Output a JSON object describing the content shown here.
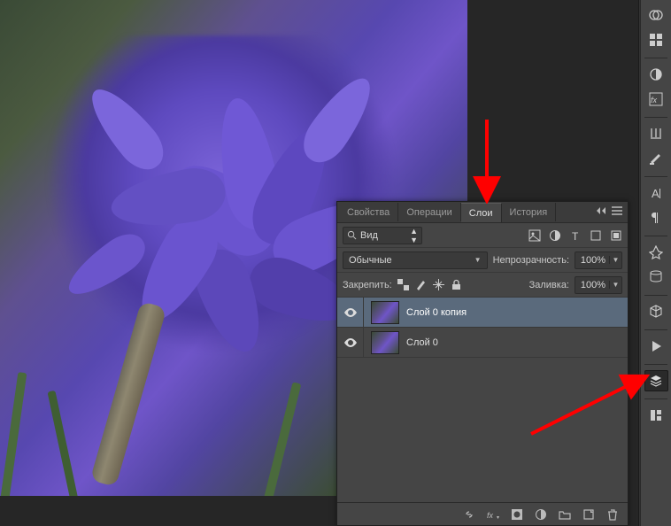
{
  "tabs": {
    "properties": "Свойства",
    "operations": "Операции",
    "layers": "Слои",
    "history": "История"
  },
  "search": {
    "label": "Вид"
  },
  "blend": {
    "mode": "Обычные",
    "opacity_label": "Непрозрачность:",
    "opacity_value": "100%"
  },
  "lock": {
    "label": "Закрепить:",
    "fill_label": "Заливка:",
    "fill_value": "100%"
  },
  "layers": [
    {
      "name": "Слой 0 копия",
      "visible": true,
      "selected": true
    },
    {
      "name": "Слой 0",
      "visible": true,
      "selected": false
    }
  ],
  "toolstrip_icons": [
    "color-swatches-icon",
    "swatches-grid-icon",
    "sep",
    "adjustments-icon",
    "styles-icon",
    "sep",
    "brushes-icon",
    "brush-presets-icon",
    "sep",
    "character-icon",
    "paragraph-icon",
    "sep",
    "navigator-icon",
    "histogram-icon",
    "sep",
    "3d-icon",
    "sep",
    "play-icon",
    "sep",
    "layers-icon",
    "sep",
    "channels-icon"
  ],
  "filter_icons": [
    "pixel-layer-icon",
    "adjustment-layer-icon",
    "type-layer-icon",
    "shape-layer-icon",
    "smart-object-icon"
  ],
  "lock_icons": [
    "lock-transparent-icon",
    "lock-image-icon",
    "lock-position-icon",
    "lock-all-icon"
  ],
  "footer_icons": [
    "link-icon",
    "fx-icon",
    "mask-icon",
    "fill-adjust-icon",
    "group-icon",
    "new-layer-icon",
    "trash-icon"
  ]
}
